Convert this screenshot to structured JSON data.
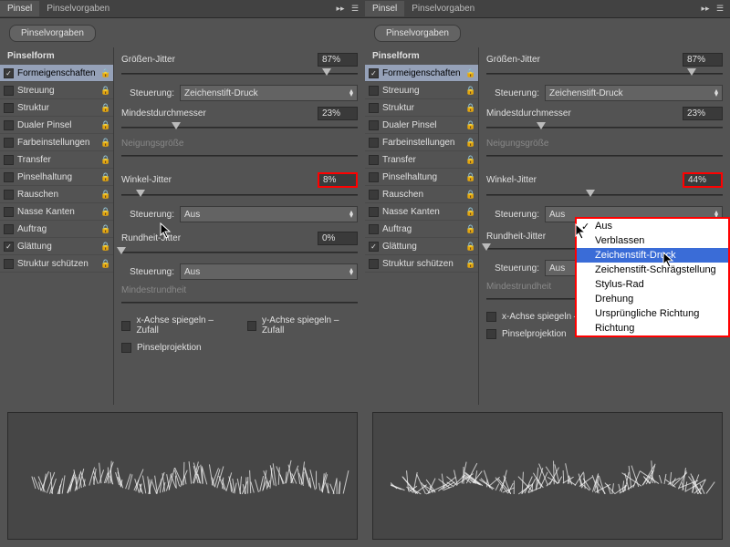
{
  "tabs": {
    "brush": "Pinsel",
    "presets": "Pinselvorgaben"
  },
  "btn_presets": "Pinselvorgaben",
  "sidebar": {
    "header": "Pinselform",
    "items": [
      {
        "label": "Formeigenschaften",
        "checked": true,
        "selected": true
      },
      {
        "label": "Streuung",
        "checked": false
      },
      {
        "label": "Struktur",
        "checked": false
      },
      {
        "label": "Dualer Pinsel",
        "checked": false
      },
      {
        "label": "Farbeinstellungen",
        "checked": false
      },
      {
        "label": "Transfer",
        "checked": false
      },
      {
        "label": "Pinselhaltung",
        "checked": false
      },
      {
        "label": "Rauschen",
        "checked": false
      },
      {
        "label": "Nasse Kanten",
        "checked": false
      },
      {
        "label": "Auftrag",
        "checked": false
      },
      {
        "label": "Glättung",
        "checked": true
      },
      {
        "label": "Struktur schützen",
        "checked": false
      }
    ]
  },
  "labels": {
    "size_jitter": "Größen-Jitter",
    "control": "Steuerung:",
    "min_diam": "Mindestdurchmesser",
    "tilt_scale": "Neigungsgröße",
    "angle_jitter": "Winkel-Jitter",
    "round_jitter": "Rundheit-Jitter",
    "min_round": "Mindestrundheit",
    "flip_x": "x-Achse spiegeln – Zufall",
    "flip_y": "y-Achse spiegeln – Zufall",
    "projection": "Pinselprojektion"
  },
  "dropdown_options": {
    "pen_pressure": "Zeichenstift-Druck",
    "off": "Aus",
    "fade": "Verblassen",
    "pen_tilt": "Zeichenstift-Schrägstellung",
    "stylus_wheel": "Stylus-Rad",
    "rotation": "Drehung",
    "initial_dir": "Ursprüngliche Richtung",
    "direction": "Richtung"
  },
  "left": {
    "size_jitter": "87%",
    "min_diam": "23%",
    "angle_jitter": "8%",
    "round_jitter": "0%",
    "size_ctrl": "Zeichenstift-Druck",
    "angle_ctrl": "Aus",
    "round_ctrl": "Aus"
  },
  "right": {
    "size_jitter": "87%",
    "min_diam": "23%",
    "angle_jitter": "44%",
    "round_jitter": "",
    "size_ctrl": "Zeichenstift-Druck",
    "angle_ctrl": "Aus",
    "round_ctrl": "Aus"
  }
}
